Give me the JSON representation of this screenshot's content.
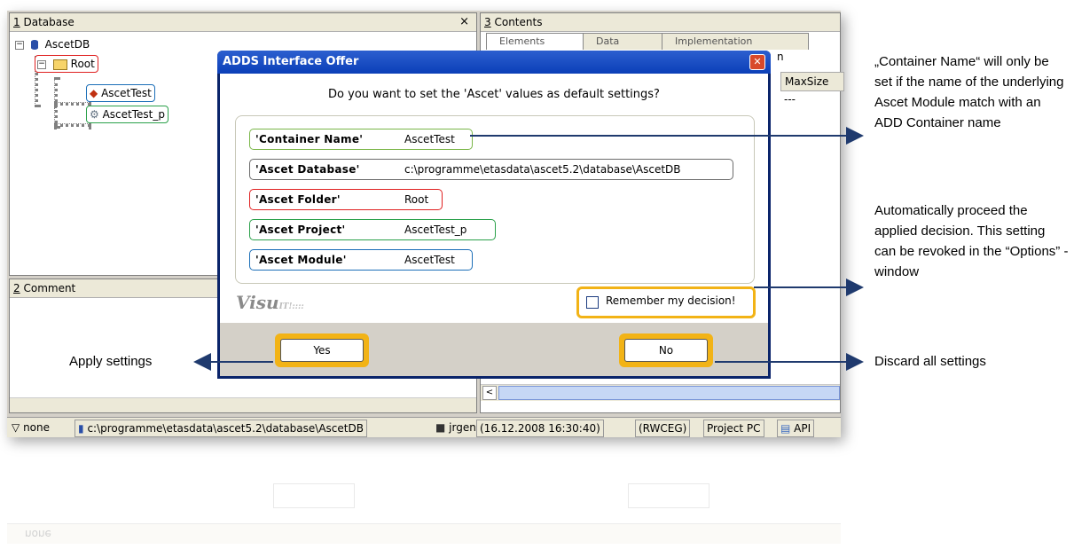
{
  "database_pane": {
    "number": "1",
    "title": "Database",
    "close": "×",
    "tree": {
      "root_db": "AscetDB",
      "folder": "Root",
      "module": "AscetTest",
      "project": "AscetTest_p"
    }
  },
  "comment_pane": {
    "number": "2",
    "title": "Comment"
  },
  "contents_pane": {
    "number": "3",
    "title": "Contents",
    "tabs": [
      "Elements",
      "Data",
      "Implementation"
    ],
    "column_fragment": "n",
    "column_header": "MaxSize",
    "cell_value": "---"
  },
  "dialog": {
    "title": "ADDS Interface Offer",
    "question": "Do you want to set the 'Ascet' values as default settings?",
    "fields": [
      {
        "label": "'Container Name'",
        "value": "AscetTest",
        "color": "#7ab648"
      },
      {
        "label": "'Ascet Database'",
        "value": "c:\\programme\\etasdata\\ascet5.2\\database\\AscetDB",
        "color": "#6b6b6b"
      },
      {
        "label": "'Ascet Folder'",
        "value": "Root",
        "color": "#e02020"
      },
      {
        "label": "'Ascet Project'",
        "value": "AscetTest_p",
        "color": "#2aa04a"
      },
      {
        "label": "'Ascet Module'",
        "value": "AscetTest",
        "color": "#1c6fb8"
      }
    ],
    "logo": "Visu",
    "remember_label": "Remember my decision!",
    "yes_label": "Yes",
    "no_label": "No"
  },
  "status_bar": {
    "filter": "none",
    "db_path": "c:\\programme\\etasdata\\ascet5.2\\database\\AscetDB",
    "user": "jrgen",
    "timestamp": "(16.12.2008 16:30:40)",
    "mode": "(RWCEG)",
    "location": "Project PC",
    "api": "API"
  },
  "annotations": {
    "container_name": "„Container Name“ will only be set if the name of the underlying Ascet Module match with an ADD Container name",
    "remember": "Automatically proceed the applied decision. This setting can be revoked in the “Options” - window",
    "apply": "Apply settings",
    "discard": "Discard all settings"
  },
  "colors": {
    "highlight": "#f2b316",
    "arrow": "#1f3a6e"
  }
}
